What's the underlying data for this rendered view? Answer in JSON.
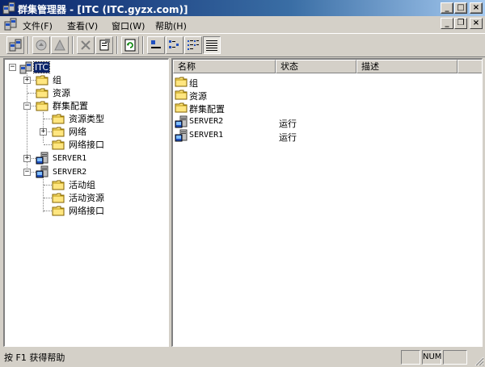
{
  "window": {
    "title": "群集管理器 - [ITC (ITC.gyzx.com)]",
    "buttons": {
      "minimize": "_",
      "maximize": "□",
      "close": "×"
    }
  },
  "menu": {
    "items": [
      {
        "label": "文件(F)"
      },
      {
        "label": "查看(V)"
      },
      {
        "label": "窗口(W)"
      },
      {
        "label": "帮助(H)"
      }
    ],
    "mdi_buttons": {
      "minimize": "_",
      "restore": "❐",
      "close": "×"
    }
  },
  "toolbar": {
    "icons": [
      "new-connection-icon",
      "bring-online-icon",
      "take-offline-icon",
      "delete-icon",
      "properties-icon",
      "refresh-icon",
      "large-icons-icon",
      "small-icons-icon",
      "list-icon",
      "details-icon"
    ]
  },
  "tree": {
    "root": "ITC",
    "nodes": [
      {
        "label": "组"
      },
      {
        "label": "资源"
      },
      {
        "label": "群集配置"
      },
      {
        "label": "资源类型"
      },
      {
        "label": "网络"
      },
      {
        "label": "网络接口"
      },
      {
        "label": "SERVER1"
      },
      {
        "label": "SERVER2"
      },
      {
        "label": "活动组"
      },
      {
        "label": "活动资源"
      },
      {
        "label": "网络接口"
      }
    ],
    "expanders": {
      "plus": "+",
      "minus": "−"
    }
  },
  "list": {
    "columns": [
      {
        "label": "名称"
      },
      {
        "label": "状态"
      },
      {
        "label": "描述"
      }
    ],
    "rows": [
      {
        "name": "组",
        "status": "",
        "description": "",
        "icon": "folder-icon"
      },
      {
        "name": "资源",
        "status": "",
        "description": "",
        "icon": "folder-icon"
      },
      {
        "name": "群集配置",
        "status": "",
        "description": "",
        "icon": "folder-icon"
      },
      {
        "name": "SERVER2",
        "status": "运行",
        "description": "",
        "icon": "server-icon"
      },
      {
        "name": "SERVER1",
        "status": "运行",
        "description": "",
        "icon": "server-icon"
      }
    ]
  },
  "statusbar": {
    "text": "按 F1 获得帮助",
    "num": "NUM"
  },
  "colors": {
    "title_active": "#0a246a",
    "face": "#d4d0c8",
    "folder": "#ffd700"
  }
}
